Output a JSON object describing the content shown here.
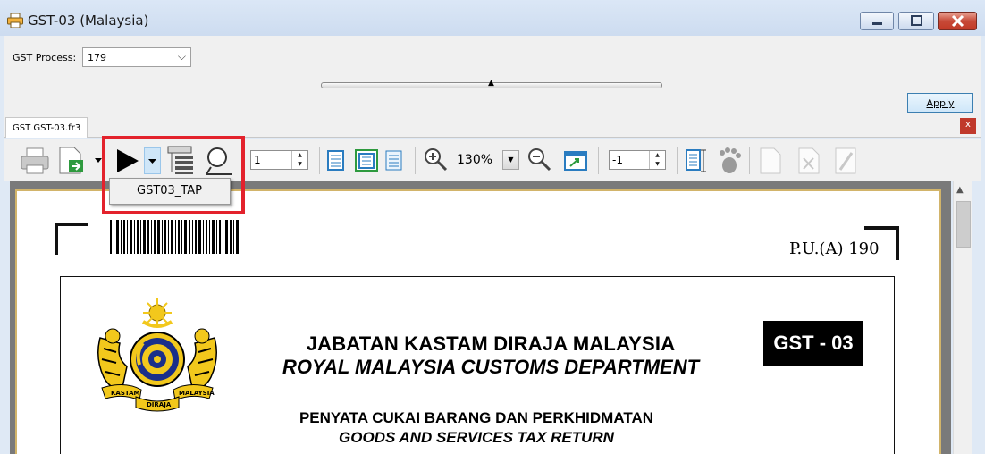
{
  "window": {
    "title": "GST-03 (Malaysia)",
    "icon": "printer-icon",
    "min_icon": "minimize-icon",
    "max_icon": "maximize-icon",
    "close_icon": "close-icon"
  },
  "params": {
    "gst_process_label": "GST Process:",
    "gst_process_value": "179",
    "apply_label": "Apply"
  },
  "tab": {
    "label": "GST GST-03.fr3",
    "close_glyph": "x"
  },
  "toolbar": {
    "page_number": "1",
    "zoom": "130%",
    "goto_value": "-1",
    "dropdown_item": "GST03_TAP"
  },
  "report": {
    "reference": "P.U.(A) 190",
    "agency_malay": "JABATAN KASTAM DIRAJA MALAYSIA",
    "agency_english": "ROYAL MALAYSIA CUSTOMS DEPARTMENT",
    "form_code": "GST - 03",
    "form_title_malay": "PENYATA CUKAI BARANG DAN PERKHIDMATAN",
    "form_title_english": "GOODS AND SERVICES TAX RETURN",
    "emblem": {
      "left_label": "KASTAM",
      "right_label": "MALAYSIA",
      "bottom_label": "DIRAJA"
    }
  },
  "colors": {
    "highlight": "#e3222c",
    "page_border": "#d2b46a",
    "accent": "#3c7fb1"
  }
}
